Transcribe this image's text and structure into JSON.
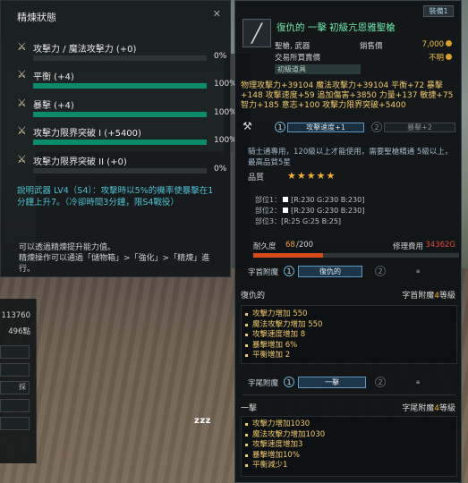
{
  "left_panel": {
    "title": "精煉狀態",
    "close": "✕",
    "stats": [
      {
        "icon": "sword-icon",
        "label": "攻擊力 / 魔法攻擊力 (+0)",
        "percent_text": "0%",
        "fill": 0.0
      },
      {
        "icon": "sword-icon",
        "label": "平衡 (+4)",
        "percent_text": "100%",
        "fill": 1.0
      },
      {
        "icon": "sword-icon",
        "label": "暴擊 (+4)",
        "percent_text": "100%",
        "fill": 1.0
      },
      {
        "icon": "sword-icon",
        "label": "攻擊力限界突破 I (+5400)",
        "percent_text": "100%",
        "fill": 1.0
      },
      {
        "icon": "sword-icon",
        "label": "攻擊力限界突破 II (+0)",
        "percent_text": "0%",
        "fill": 0.0
      }
    ],
    "description": "說明武器 LV4（S4）：攻擊時以5%的機率使暴擊在1分鐘上升7。（冷卻時間3分鐘，限S4戰役）",
    "note": "可以透過精煉提升能力值。\n精煉操作可以通過「儲物箱」>「強化」>「精煉」進行。"
  },
  "lower_left": {
    "values": [
      "113760",
      "496點"
    ],
    "button_partial": "採"
  },
  "overlay": {
    "zzz": "zzz"
  },
  "right_panel": {
    "top_button": "裝備1",
    "item_name": "復仇的 一擊 初級亢恩雅聖槍",
    "info_rows": [
      {
        "left": "聖槍, 武器",
        "mid": "銷售價",
        "right": "7,000"
      },
      {
        "left": "交易所買賣價",
        "mid": "",
        "right": "不明"
      }
    ],
    "tag": "初級道具",
    "stats_text": "物理攻擊力+39104 魔法攻擊力+39104 平衡+72 暴擊+148 攻擊速度+59 追加傷害+3850 力量+137 敏捷+75 智力+185 意志+100 攻擊力限界突破+5400",
    "enhance_steps": [
      {
        "num": "1",
        "label": "攻擊速度+1",
        "active": true
      },
      {
        "num": "2",
        "label": "暴擊+2",
        "active": false
      }
    ],
    "requirement": "騎士通專用，120級以上才能使用，需要聖槍精通 5級以上，最高品質5星",
    "grade_label": "品質",
    "stars": "★★★★★",
    "grade_desc": "",
    "parts": [
      {
        "label": "部位1：",
        "rgb": "[R:230 G:230 B:230]"
      },
      {
        "label": "部位2：",
        "rgb": "[R:230 G:230 B:230]"
      },
      {
        "label": "部位3：",
        "rgb": "[R:25 G:25 B:25]"
      }
    ],
    "durability_label": "耐久度",
    "durability_value": "68",
    "durability_max": "/200",
    "durability_fill": 0.34,
    "repair_label": "修理費用",
    "repair_value": "34362G",
    "prefix_slot": {
      "label": "字首附魔",
      "step1": "1",
      "selected": "復仇的",
      "step2": "2"
    },
    "prefix_section": {
      "name": "復仇的",
      "grade_prefix": "字首附魔",
      "level": "4",
      "level_suffix": "等級",
      "items": [
        "攻擊力增加 550",
        "魔法攻擊力增加 550",
        "攻擊速度增加 8",
        "暴擊增加 6%",
        "平衡增加 2"
      ]
    },
    "suffix_slot": {
      "label": "字尾附魔",
      "step1": "1",
      "selected": "一擊",
      "step2": "2"
    },
    "suffix_section": {
      "name": "一擊",
      "grade_prefix": "字尾附魔",
      "level": "4",
      "level_suffix": "等級",
      "items": [
        "攻擊力增加1030",
        "魔法攻擊力增加1030",
        "攻擊速度增加3",
        "暴擊增加10%",
        "平衡減少1"
      ]
    }
  }
}
